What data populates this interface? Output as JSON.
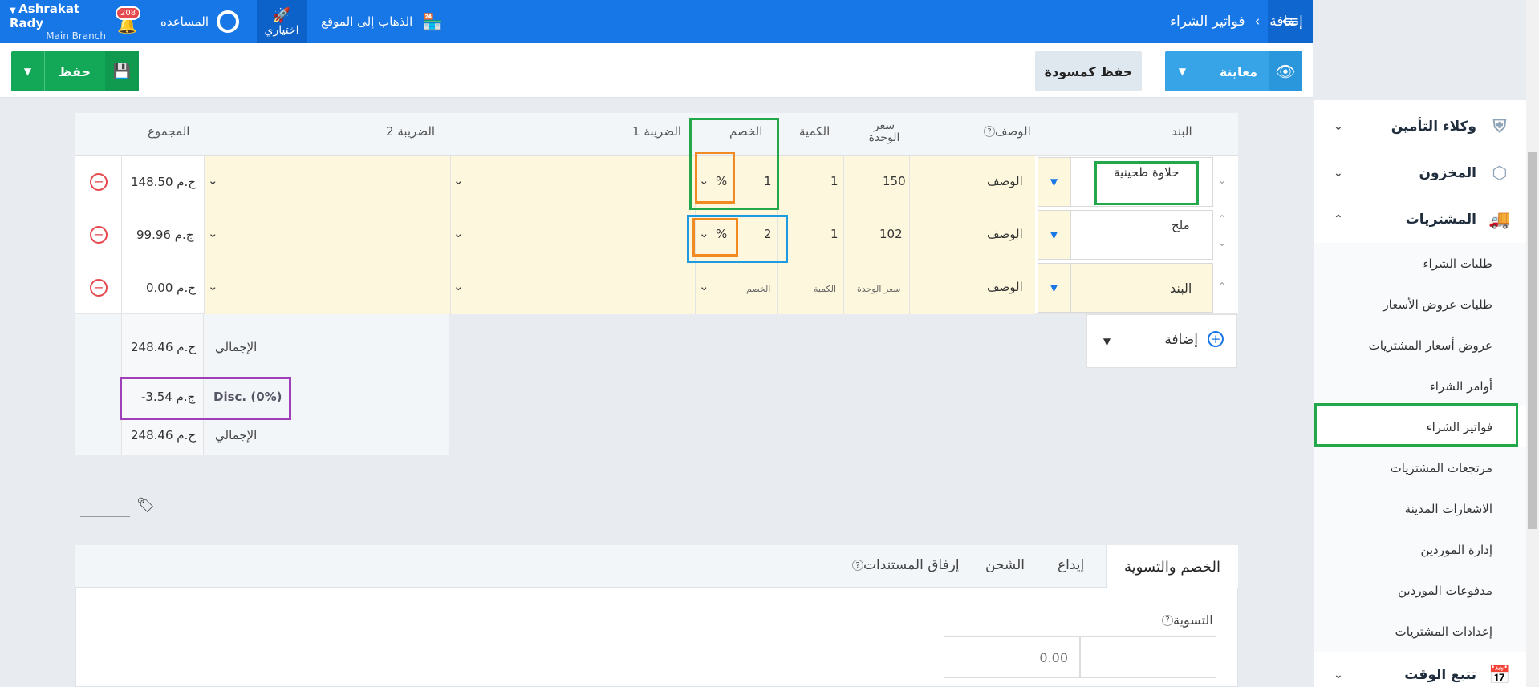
{
  "topbar": {
    "breadcrumb_parent": "فواتير الشراء",
    "breadcrumb_current": "إضافة",
    "go_to_site": "الذهاب إلى الموقع",
    "optional": "اختياري",
    "help": "المساعده",
    "notification_count": "208",
    "user_name": "Ashrakat Rady",
    "branch": "Main Branch"
  },
  "toolbar": {
    "preview": "معاينة",
    "save_draft": "حفظ كمسودة",
    "save": "حفظ"
  },
  "table": {
    "headers": {
      "item": "البند",
      "description": "الوصف",
      "unit_price": "سعر الوحدة",
      "quantity": "الكمية",
      "discount": "الخصم",
      "tax1": "الضريبة 1",
      "tax2": "الضريبة 2",
      "total": "المجموع"
    },
    "rows": [
      {
        "item": "حلاوة طحينية",
        "description": "الوصف",
        "unit_price": "150",
        "quantity": "1",
        "discount": "1",
        "discount_type": "%",
        "total": "148.50 ج.م"
      },
      {
        "item": "ملح",
        "description": "الوصف",
        "unit_price": "102",
        "quantity": "1",
        "discount": "2",
        "discount_type": "%",
        "total": "99.96 ج.م"
      }
    ],
    "empty_row": {
      "item": "البند",
      "description": "الوصف",
      "unit_price": "سعر الوحدة",
      "quantity": "الكمية",
      "discount": "الخصم",
      "total": "0.00 ج.م"
    },
    "add_label": "إضافة",
    "summary": {
      "subtotal_label": "الإجمالي",
      "subtotal": "248.46 ج.م",
      "disc_label": "Disc. (0%)",
      "disc": "-3.54 ج.م",
      "total_label": "الإجمالي",
      "total": "248.46 ج.م"
    }
  },
  "tabs": [
    "الخصم والتسوية",
    "إيداع",
    "الشحن",
    "إرفاق المستندات"
  ],
  "adjustment": {
    "label": "التسوية",
    "placeholder": "0.00"
  },
  "sidebar": {
    "main": [
      {
        "label": "وكلاء التأمين",
        "icon": "shield-icon"
      },
      {
        "label": "المخزون",
        "icon": "box-icon"
      },
      {
        "label": "المشتريات",
        "icon": "truck-icon"
      },
      {
        "label": "تتبع الوقت",
        "icon": "calendar-clock-icon"
      }
    ],
    "sub": [
      "طلبات الشراء",
      "طلبات عروض الأسعار",
      "عروض أسعار المشتريات",
      "أوامر الشراء",
      "فواتير الشراء",
      "مرتجعات المشتريات",
      "الاشعارات المدينة",
      "إدارة الموردين",
      "مدفوعات الموردين",
      "إعدادات المشتريات"
    ]
  },
  "colors": {
    "primary": "#1877e6",
    "save": "#13a858",
    "highlight_green": "#22a84a",
    "highlight_orange": "#f28a22",
    "highlight_blue": "#1e9be0",
    "highlight_purple": "#a040b8"
  }
}
